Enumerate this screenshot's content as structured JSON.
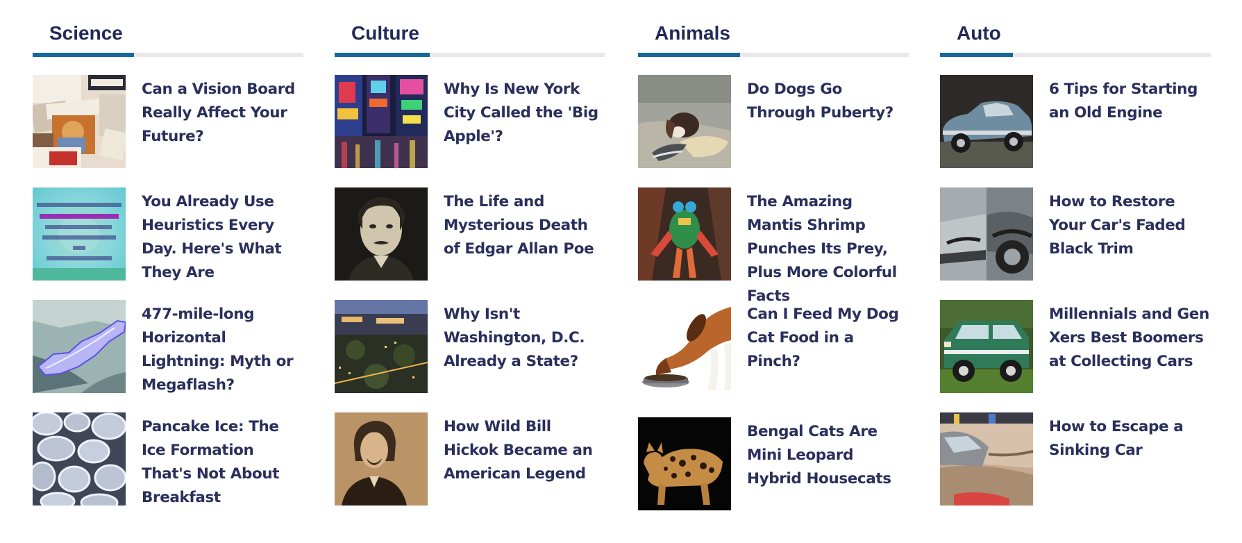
{
  "columns": [
    {
      "title": "Science",
      "items": [
        {
          "title": "Can a Vision Board Really Affect Your Future?",
          "image": "vision-board-collage"
        },
        {
          "title": "You Already Use Heuristics Every Day. Here's What They Are",
          "image": "heuristics-definition-graphic",
          "image_text": "help us make decisions we use HEURISTICS, also known as \"cognitive shortcuts\" or \"rules of thumb.\""
        },
        {
          "title": "477-mile-long Horizontal Lightning: Myth or Megaflash?",
          "image": "megaflash-satellite-map"
        },
        {
          "title": "Pancake Ice: The Ice Formation That's Not About Breakfast",
          "image": "pancake-ice-photo"
        }
      ]
    },
    {
      "title": "Culture",
      "items": [
        {
          "title": "Why Is New York City Called the 'Big Apple'?",
          "image": "times-square-night"
        },
        {
          "title": "The Life and Mysterious Death of Edgar Allan Poe",
          "image": "poe-portrait"
        },
        {
          "title": "Why Isn't Washington, D.C. Already a State?",
          "image": "dc-skyline-dusk"
        },
        {
          "title": "How Wild Bill Hickok Became an American Legend",
          "image": "hickok-sepia-portrait"
        }
      ]
    },
    {
      "title": "Animals",
      "items": [
        {
          "title": "Do Dogs Go Through Puberty?",
          "image": "puppy-chewing-shoe"
        },
        {
          "title": "The Amazing Mantis Shrimp Punches Its Prey, Plus More Colorful Facts",
          "image": "mantis-shrimp"
        },
        {
          "title": "Can I Feed My Dog Cat Food in a Pinch?",
          "image": "beagle-eating-from-bowl"
        },
        {
          "title": "Bengal Cats Are Mini Leopard Hybrid Housecats",
          "image": "bengal-cat"
        }
      ]
    },
    {
      "title": "Auto",
      "items": [
        {
          "title": "6 Tips for Starting an Old Engine",
          "image": "vintage-blue-car"
        },
        {
          "title": "How to Restore Your Car's Faded Black Trim",
          "image": "jeep-fender-trim"
        },
        {
          "title": "Millennials and Gen Xers Best Boomers at Collecting Cars",
          "image": "green-ford-bronco"
        },
        {
          "title": "How to Escape a Sinking Car",
          "image": "car-in-sinkhole"
        }
      ]
    }
  ],
  "colors": {
    "heading": "#232957",
    "link": "#2a2f5c",
    "accent": "#14689e",
    "track": "#e9e9ec",
    "background": "#ffffff"
  }
}
